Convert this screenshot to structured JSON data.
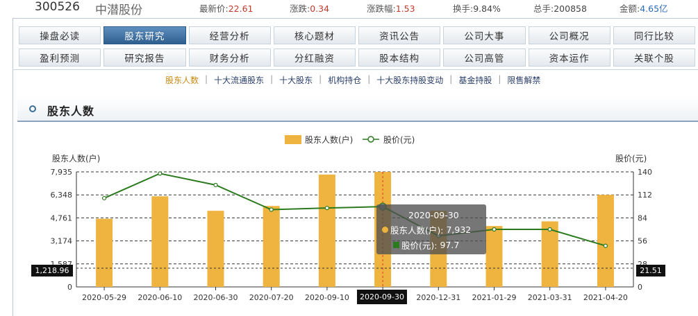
{
  "quote": {
    "code": "300526",
    "name": "中潜股份",
    "latest_price_label": "最新价:",
    "latest_price": "22.61",
    "change_label": "涨跌:",
    "change": "0.34",
    "change_pct_label": "涨跌幅:",
    "change_pct": "1.53",
    "turnover_label": "换手:",
    "turnover": "9.84%",
    "volume_label": "总手:",
    "volume": "200858",
    "amount_label": "金额:",
    "amount": "4.65亿"
  },
  "nav": {
    "row1": [
      "操盘必读",
      "股东研究",
      "经营分析",
      "核心题材",
      "资讯公告",
      "公司大事",
      "公司概况",
      "同行比较"
    ],
    "row2": [
      "盈利预测",
      "研究报告",
      "财务分析",
      "分红融资",
      "股本结构",
      "公司高管",
      "资本运作",
      "关联个股"
    ],
    "active": "股东研究"
  },
  "sub_tabs": {
    "items": [
      "股东人数",
      "十大流通股东",
      "十大股东",
      "机构持仓",
      "十大股东持股变动",
      "基金持股",
      "限售解禁"
    ],
    "active": "股东人数"
  },
  "section": {
    "title": "股东人数"
  },
  "chart_data": {
    "type": "bar",
    "legend": [
      "股东人数(户)",
      "股价(元)"
    ],
    "ylabel": "股东人数(户)",
    "y2label": "股价(元)",
    "categories": [
      "2020-05-29",
      "2020-06-10",
      "2020-06-30",
      "2020-07-20",
      "2020-09-10",
      "2020-09-30",
      "2020-12-31",
      "2021-01-29",
      "2021-03-31",
      "2021-04-20"
    ],
    "series": [
      {
        "name": "股东人数(户)",
        "type": "bar",
        "values": [
          4700,
          6250,
          5250,
          5580,
          7750,
          7932,
          5250,
          4200,
          4520,
          6350
        ]
      },
      {
        "name": "股价(元)",
        "type": "line",
        "values": [
          108,
          138,
          124,
          94,
          96,
          97.7,
          62,
          70,
          70,
          50
        ]
      }
    ],
    "y_ticks": [
      "7,935",
      "6,348",
      "4,761",
      "3,174",
      "1,587",
      "0"
    ],
    "y2_ticks": [
      "140",
      "112",
      "84",
      "56",
      "28",
      "0"
    ],
    "ylim": [
      0,
      7935
    ],
    "y2lim": [
      0,
      140
    ],
    "bar_color": "#efb440",
    "line_color": "#2b7a1e",
    "grid": true,
    "crosshair": {
      "date": "2020-09-30",
      "left_value": "1,218.96",
      "right_value": "21.51"
    },
    "tooltip": {
      "date": "2020-09-30",
      "holders_label": "股东人数(户):",
      "holders_value": "7,932",
      "price_label": "股价(元):",
      "price_value": "97.7"
    }
  }
}
